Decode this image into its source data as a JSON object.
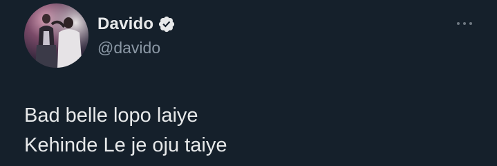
{
  "author": {
    "display_name": "Davido",
    "handle": "@davido",
    "verified": true,
    "avatar_icon": "profile-photo-avatar"
  },
  "tweet": {
    "lines": [
      "Bad belle lopo laiye",
      "Kehinde Le je oju taiye"
    ]
  },
  "menu": {
    "icon": "more-options-icon"
  },
  "colors": {
    "background": "#15202b",
    "primary_text": "#e7e9ea",
    "secondary_text": "#8b98a5",
    "verified_badge": "#e7e9ea"
  }
}
